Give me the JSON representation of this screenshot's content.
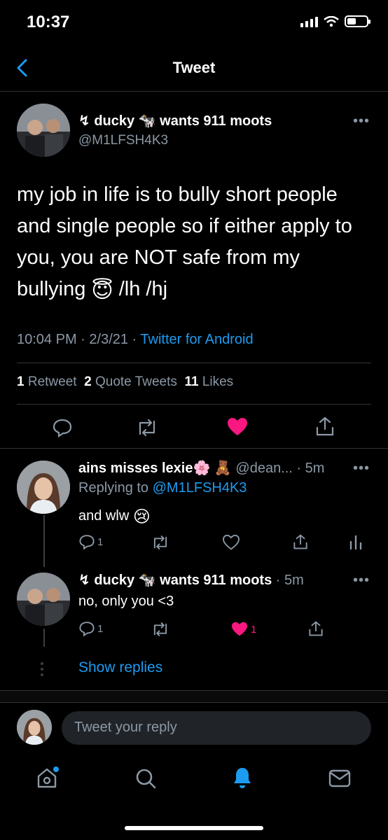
{
  "status_bar": {
    "time": "10:37"
  },
  "header": {
    "title": "Tweet"
  },
  "tweet": {
    "display_name": "↯ ducky",
    "name_emoji": "🐄",
    "name_suffix": "wants 911 moots",
    "handle": "@M1LFSH4K3",
    "text_part1": "my job in life is to bully short people and single people so if either apply to you, you are NOT safe from my bullying",
    "text_emoji": "😇",
    "text_part2": "/lh /hj",
    "time": "10:04 PM",
    "date": "2/3/21",
    "source": "Twitter for Android",
    "retweets": "1",
    "retweets_label": "Retweet",
    "quote_tweets": "2",
    "quote_tweets_label": "Quote Tweets",
    "likes": "11",
    "likes_label": "Likes"
  },
  "replies": [
    {
      "display_name": "ains misses lexie",
      "name_emojis": "🌸 🧸",
      "handle": "@dean...",
      "time": "5m",
      "replying_label": "Replying to",
      "replying_to": "@M1LFSH4K3",
      "text": "and wlw",
      "text_emoji": "😢",
      "reply_count": "1"
    },
    {
      "display_name": "↯ ducky",
      "name_emoji": "🐄",
      "name_suffix": "wants 911 moots",
      "time": "5m",
      "text": "no, only you <3",
      "reply_count": "1",
      "like_count": "1"
    }
  ],
  "show_replies": "Show replies",
  "composer": {
    "placeholder": "Tweet your reply"
  },
  "tab_bar": {
    "items": [
      "home-icon",
      "search-icon",
      "notifications-icon",
      "messages-icon"
    ]
  },
  "colors": {
    "accent": "#1d9bf0",
    "like": "#f91880",
    "background": "#000000"
  }
}
